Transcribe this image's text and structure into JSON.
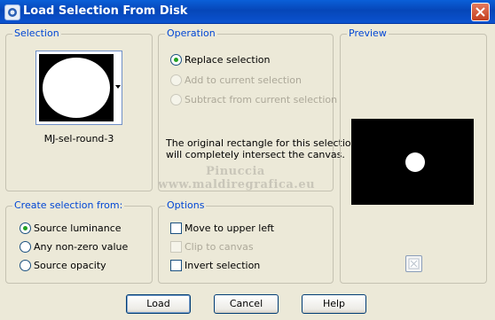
{
  "window": {
    "title": "Load Selection From Disk",
    "icon": "app-icon",
    "close_icon": "close-icon"
  },
  "selection": {
    "label": "Selection",
    "selected_name": "MJ-sel-round-3"
  },
  "operation": {
    "label": "Operation",
    "options": [
      {
        "label": "Replace selection",
        "checked": true,
        "enabled": true
      },
      {
        "label": "Add to current selection",
        "checked": false,
        "enabled": false
      },
      {
        "label": "Subtract from current selection",
        "checked": false,
        "enabled": false
      }
    ],
    "note_line1": "The original rectangle for this selection",
    "note_line2": "will completely intersect the canvas."
  },
  "watermark": {
    "line1": "Pinuccia",
    "line2": "www.maldiregrafica.eu"
  },
  "preview": {
    "label": "Preview"
  },
  "create_from": {
    "label": "Create selection from:",
    "options": [
      {
        "label": "Source luminance",
        "checked": true
      },
      {
        "label": "Any non-zero value",
        "checked": false
      },
      {
        "label": "Source opacity",
        "checked": false
      }
    ]
  },
  "options": {
    "label": "Options",
    "items": [
      {
        "label": "Move to upper left",
        "checked": false,
        "enabled": true
      },
      {
        "label": "Clip to canvas",
        "checked": false,
        "enabled": false
      },
      {
        "label": "Invert selection",
        "checked": false,
        "enabled": true
      }
    ]
  },
  "buttons": {
    "load": "Load",
    "cancel": "Cancel",
    "help": "Help"
  },
  "colors": {
    "group_label": "#0046d5",
    "titlebar": "#0646b8",
    "radio_check": "#21a121"
  }
}
